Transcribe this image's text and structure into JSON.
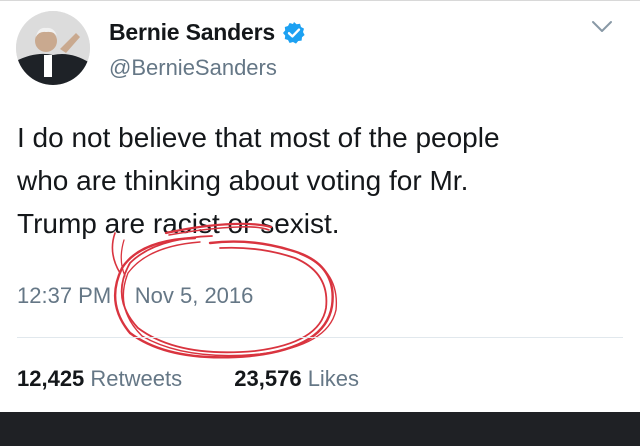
{
  "user": {
    "display_name": "Bernie Sanders",
    "handle": "@BernieSanders",
    "verified": true
  },
  "tweet": {
    "lines": [
      "I do not believe that most of the people",
      "who are thinking about voting for Mr.",
      "Trump are racist or sexist."
    ],
    "time": "12:37 PM",
    "separator": "·",
    "date": "Nov 5, 2016"
  },
  "stats": {
    "retweets_count": "12,425",
    "retweets_label": "Retweets",
    "likes_count": "23,576",
    "likes_label": "Likes"
  },
  "colors": {
    "text": "#14171a",
    "secondary": "#657786",
    "verified_badge": "#1da1f2",
    "annotation_red": "#d9343f"
  },
  "icons": {
    "verified": "verified-badge-icon",
    "caret": "chevron-down-icon"
  }
}
